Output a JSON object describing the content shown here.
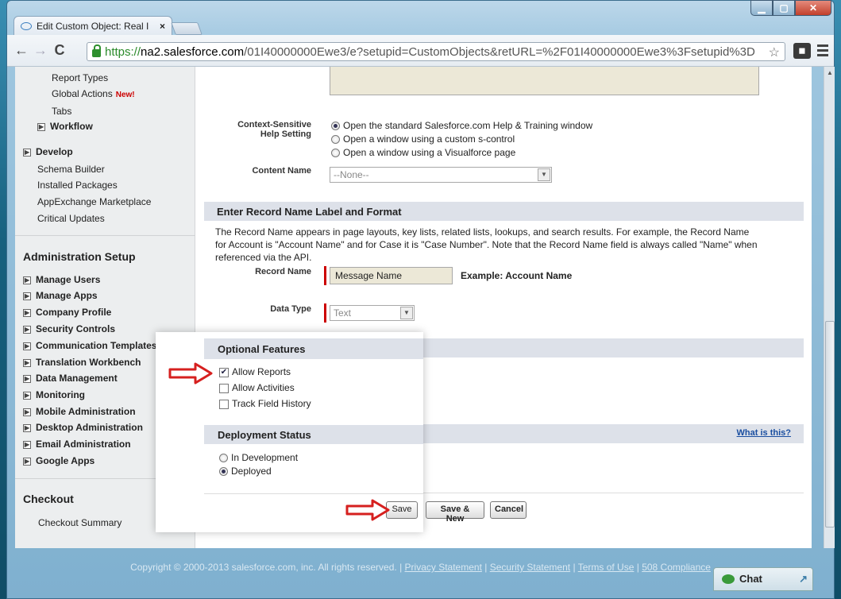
{
  "browser": {
    "tab_title": "Edit Custom Object: Real I",
    "tab_close": "×",
    "url_https": "https://",
    "url_domain": "na2.salesforce.com",
    "url_rest": "/01I40000000Ewe3/e?setupid=CustomObjects&retURL=%2F01I40000000Ewe3%3Fsetupid%3D"
  },
  "sidebar": {
    "items_top": [
      {
        "label": "Report Types"
      },
      {
        "label": "Global Actions",
        "badge": "New!"
      },
      {
        "label": "Tabs"
      },
      {
        "label": "Workflow"
      }
    ],
    "develop": {
      "label": "Develop",
      "children": [
        "Schema Builder",
        "Installed Packages",
        "AppExchange Marketplace",
        "Critical Updates"
      ]
    },
    "admin_heading": "Administration Setup",
    "admin_items": [
      "Manage Users",
      "Manage Apps",
      "Company Profile",
      "Security Controls",
      "Communication Templates",
      "Translation Workbench",
      "Data Management",
      "Monitoring",
      "Mobile Administration",
      "Desktop Administration",
      "Email Administration",
      "Google Apps"
    ],
    "checkout_heading": "Checkout",
    "checkout_items": [
      "Checkout Summary"
    ]
  },
  "form": {
    "help_setting_label_1": "Context-Sensitive",
    "help_setting_label_2": "Help Setting",
    "help_options": [
      {
        "label": "Open the standard Salesforce.com Help & Training window",
        "selected": true
      },
      {
        "label": "Open a window using a custom s-control",
        "selected": false
      },
      {
        "label": "Open a window using a Visualforce page",
        "selected": false
      }
    ],
    "content_name_label": "Content Name",
    "content_name_value": "--None--",
    "record_section": "Enter Record Name Label and Format",
    "record_desc_1": "The Record Name appears in page layouts, key lists, related lists, lookups, and search results. For example, the Record Name",
    "record_desc_2": "for Account is \"Account Name\" and for Case it is \"Case Number\". Note that the Record Name field is always called \"Name\" when",
    "record_desc_3": "referenced via the API.",
    "record_name_label": "Record Name",
    "record_name_value": "Message Name",
    "example_label": "Example:",
    "example_value": "Account Name",
    "data_type_label": "Data Type",
    "data_type_value": "Text",
    "optional_section": "Optional Features",
    "optional_items": [
      {
        "label": "Allow Reports",
        "checked": true
      },
      {
        "label": "Allow Activities",
        "checked": false
      },
      {
        "label": "Track Field History",
        "checked": false
      }
    ],
    "deployment_section": "Deployment Status",
    "what_is_this": "What is this?",
    "deployment_options": [
      {
        "label": "In Development",
        "selected": false
      },
      {
        "label": "Deployed",
        "selected": true
      }
    ],
    "save": "Save",
    "save_new": "Save & New",
    "cancel": "Cancel"
  },
  "footer": {
    "copyright": "Copyright © 2000-2013 salesforce.com, inc. All rights reserved. |",
    "privacy": "Privacy Statement",
    "security": "Security Statement",
    "terms": "Terms of Use",
    "compliance": "508 Compliance",
    "sep": "|"
  },
  "chat": {
    "label": "Chat"
  },
  "colors": {
    "arrow": "#d6201f",
    "link": "#1a4ea0",
    "required": "#cc0000"
  }
}
